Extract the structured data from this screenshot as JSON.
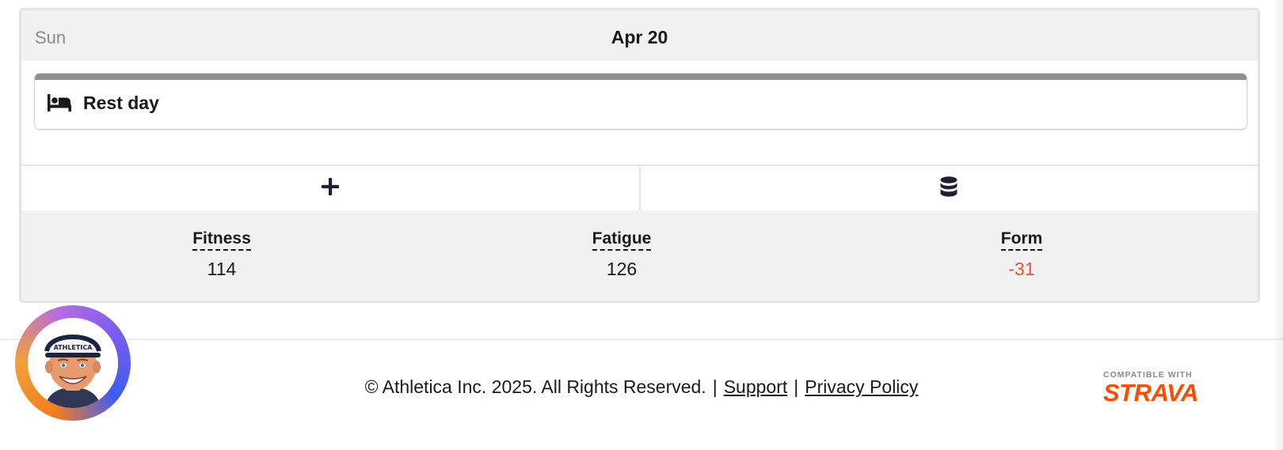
{
  "day": {
    "weekday": "Sun",
    "date": "Apr 20"
  },
  "workout": {
    "icon": "bed-icon",
    "label": "Rest day",
    "bar_color": "#8f8f8f"
  },
  "actions": {
    "add_icon": "plus-icon",
    "database_icon": "database-icon"
  },
  "metrics": [
    {
      "label": "Fitness",
      "value": "114"
    },
    {
      "label": "Fatigue",
      "value": "126"
    },
    {
      "label": "Form",
      "value": "-31",
      "color": "#e5533d"
    }
  ],
  "footer": {
    "copyright": "© Athletica Inc. 2025. All Rights Reserved.",
    "separator": "|",
    "support_link": "Support",
    "privacy_link": "Privacy Policy",
    "avatar_logo_text": "ATHLETICA",
    "strava_compatible": "COMPATIBLE WITH",
    "strava_word": "STRAVA",
    "strava_color": "#fc4c02"
  }
}
